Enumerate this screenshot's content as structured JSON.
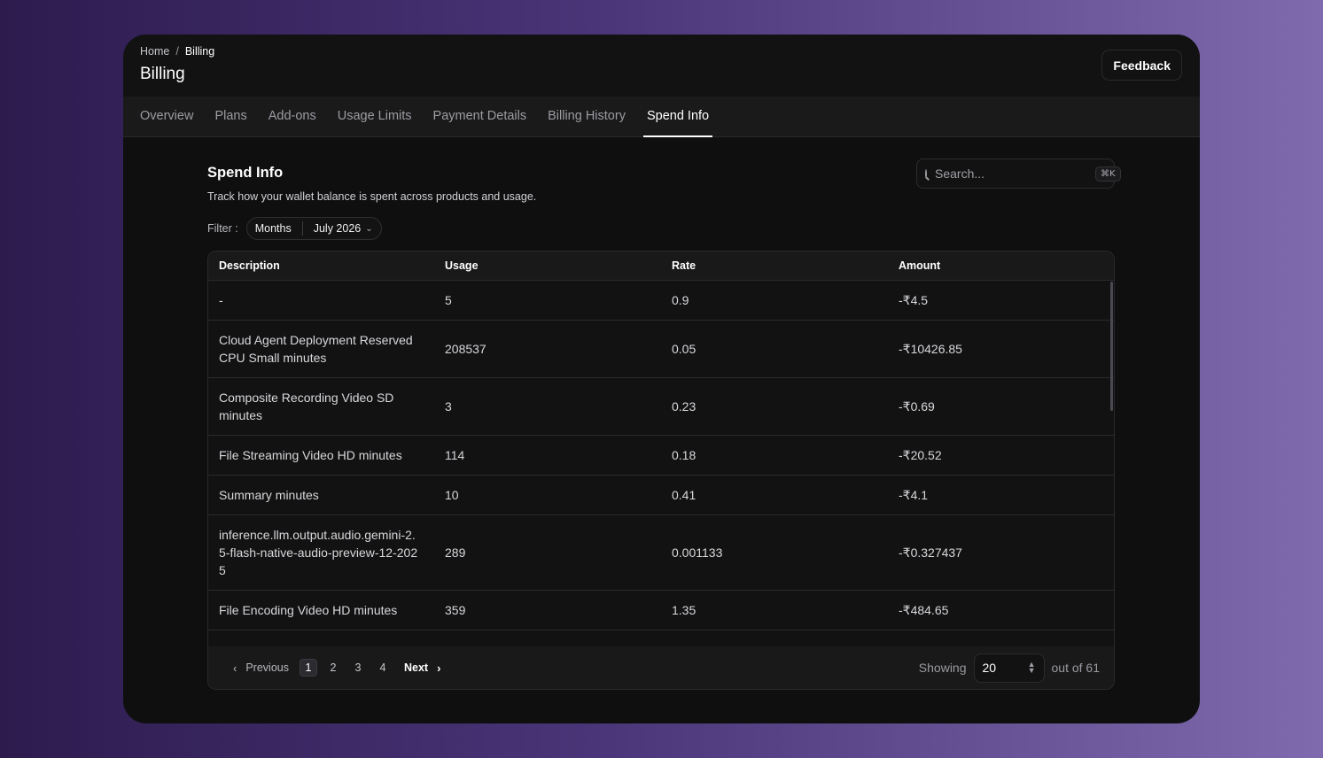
{
  "breadcrumb": [
    "Home",
    "Billing"
  ],
  "breadcrumb_sep": "/",
  "page_title": "Billing",
  "feedback_label": "Feedback",
  "tabs": [
    "Overview",
    "Plans",
    "Add-ons",
    "Usage Limits",
    "Payment Details",
    "Billing History",
    "Spend Info"
  ],
  "active_tab": "Spend Info",
  "section": {
    "title": "Spend Info",
    "description": "Track how your wallet balance is spent across products and usage."
  },
  "search": {
    "placeholder": "Search...",
    "shortcut": "⌘K"
  },
  "filter": {
    "label": "Filter :",
    "period": "Months",
    "month": "July 2026"
  },
  "table": {
    "headers": [
      "Description",
      "Usage",
      "Rate",
      "Amount"
    ],
    "rows": [
      [
        "-",
        "5",
        "0.9",
        "-₹4.5"
      ],
      [
        "Cloud Agent Deployment Reserved CPU Small minutes",
        "208537",
        "0.05",
        "-₹10426.85"
      ],
      [
        "Composite Recording Video SD minutes",
        "3",
        "0.23",
        "-₹0.69"
      ],
      [
        "File Streaming Video HD minutes",
        "114",
        "0.18",
        "-₹20.52"
      ],
      [
        "Summary minutes",
        "10",
        "0.41",
        "-₹4.1"
      ],
      [
        "inference.llm.output.audio.gemini-2.5-flash-native-audio-preview-12-2025",
        "289",
        "0.001133",
        "-₹0.327437"
      ],
      [
        "File Encoding Video HD minutes",
        "359",
        "1.35",
        "-₹484.65"
      ]
    ]
  },
  "pagination": {
    "previous": "Previous",
    "next": "Next",
    "pages": [
      "1",
      "2",
      "3",
      "4"
    ],
    "current": "1",
    "showing_label": "Showing",
    "page_size": "20",
    "total_label": "out of 61"
  }
}
